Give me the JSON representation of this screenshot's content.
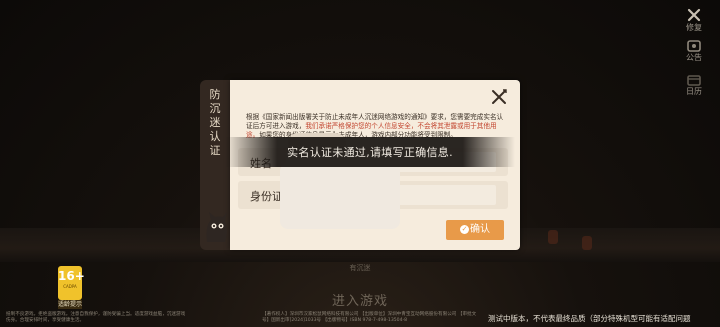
{
  "top_icons": [
    {
      "icon": "wrench-cross-icon",
      "label": "修复"
    },
    {
      "icon": "ticket-icon",
      "label": "公告"
    },
    {
      "icon": "calendar-icon",
      "label": "日历"
    }
  ],
  "panel": {
    "tab_title": "防沉迷认证",
    "notice_normal_1": "根据《国家新闻出版署关于防止未成年人沉迷网络游戏的通知》要求，您需要完成实名认证后方可进入游戏，",
    "notice_warn": "我们承诺严格保护您的个人信息安全，不会将其泄露或用于其他用途。",
    "notice_normal_2": "如果您的身份证信息显示为未成年人，游戏内部分功能将受到限制。",
    "fields": [
      {
        "label": "姓名",
        "value": ""
      },
      {
        "label": "身份证",
        "value": ""
      }
    ],
    "confirm_label": "确认"
  },
  "toast": {
    "message": "实名认证未通过,请填写正确信息."
  },
  "age_badge": {
    "number": "16+",
    "sub": "CADPA",
    "bottom": "适龄提示"
  },
  "footer": {
    "left_notice": "抵制不良游戏，拒绝盗版游戏。注意自我保护，谨防受骗上当。适度游戏益脑，沉迷游戏伤身。合理安排时间，享受健康生活。",
    "credits": "【著作权人】深圳市汉家松鼠网络科技有限公司  【出版单位】深圳中青宝互动网络股份有限公司  【审批文号】国新出审[2024]1033号  【出版物号】ISBN 978-7-498-13504-8",
    "test_notice": "测试中版本，不代表最终品质（部分特殊机型可能有适配问题",
    "enter_game": "进入游戏",
    "small_button": "有沉迷"
  }
}
